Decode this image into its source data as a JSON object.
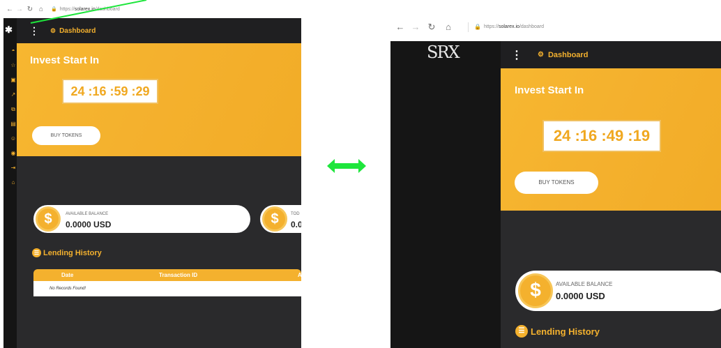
{
  "browser": {
    "left_url_scheme": "https://",
    "left_url_domain": "solarex.io",
    "left_url_path": "/dashboard",
    "right_url_scheme": "https://",
    "right_url_domain": "solarex.io",
    "right_url_path": "/dashboard"
  },
  "app": {
    "logo_text": "SRX",
    "topbar_title": "Dashboard"
  },
  "sidebar": {
    "items": [
      {
        "label": "Dashboard",
        "icon": "dashboard-icon"
      },
      {
        "label": "ICO",
        "icon": "ico-icon"
      },
      {
        "label": "Withdraw",
        "icon": "withdraw-icon"
      },
      {
        "label": "Transfer",
        "icon": "transfer-icon"
      },
      {
        "label": "All Transaction",
        "icon": "transaction-icon"
      },
      {
        "label": "Make Deposit",
        "icon": "deposit-icon"
      },
      {
        "label": "Tell a friend",
        "icon": "friend-icon"
      },
      {
        "label": "Support",
        "icon": "support-icon"
      },
      {
        "label": "Settings",
        "icon": "settings-icon"
      },
      {
        "label": "logout",
        "icon": "logout-icon"
      }
    ]
  },
  "hero": {
    "title": "Invest Start In",
    "timer_left": "24 :16 :59 :29",
    "timer_right": "24 :16 :49 :19",
    "buy_label": "BUY TOKENS"
  },
  "balance": {
    "label": "AVAILABLE BALANCE",
    "value": "0.0000 USD",
    "second_label_partial": "TOD",
    "second_value_partial": "0.0"
  },
  "lending": {
    "title": "Lending History",
    "columns": [
      "Date",
      "Transaction ID",
      "A"
    ],
    "empty_text": "No Records Found!"
  },
  "colors": {
    "accent": "#f4b12e",
    "annotation_arrow": "#1ee63c"
  }
}
